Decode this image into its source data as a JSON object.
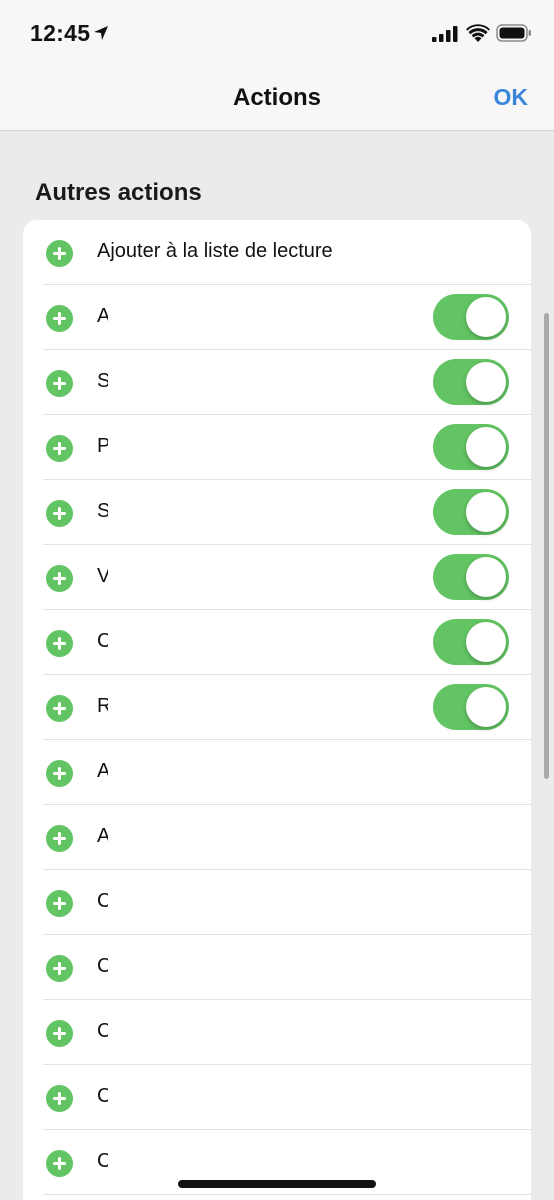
{
  "status_bar": {
    "time": "12:45",
    "icons": [
      "location-arrow-icon",
      "cellular-signal-icon",
      "wifi-icon",
      "battery-icon"
    ]
  },
  "nav": {
    "title": "Actions",
    "ok_label": "OK"
  },
  "section": {
    "header": "Autres actions"
  },
  "rows": [
    {
      "label": "Ajouter à la liste de lecture",
      "has_toggle": false
    },
    {
      "label": "A",
      "has_toggle": true,
      "toggle_on": true
    },
    {
      "label": "S",
      "has_toggle": true,
      "toggle_on": true
    },
    {
      "label": "P",
      "has_toggle": true,
      "toggle_on": true
    },
    {
      "label": "S",
      "has_toggle": true,
      "toggle_on": true
    },
    {
      "label": "V",
      "has_toggle": true,
      "toggle_on": true
    },
    {
      "label": "C",
      "has_toggle": true,
      "toggle_on": true
    },
    {
      "label": "R",
      "has_toggle": true,
      "toggle_on": true
    },
    {
      "label": "A",
      "has_toggle": false
    },
    {
      "label": "A",
      "has_toggle": false
    },
    {
      "label": "C",
      "has_toggle": false
    },
    {
      "label": "C",
      "has_toggle": false
    },
    {
      "label": "C",
      "has_toggle": false
    },
    {
      "label": "C",
      "has_toggle": false
    },
    {
      "label": "C",
      "has_toggle": false
    }
  ],
  "colors": {
    "accent_blue": "#3b86d9",
    "add_green": "#62c462",
    "toggle_on_green": "#62c462",
    "background": "#ebebeb",
    "card": "#ffffff"
  }
}
